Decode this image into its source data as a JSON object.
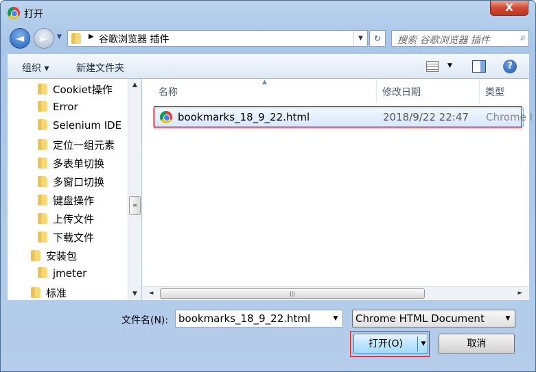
{
  "window": {
    "title": "打开",
    "close_label": "X"
  },
  "nav": {
    "back_glyph": "◄",
    "forward_glyph": "►",
    "history_glyph": "▼",
    "path_separator": "▶",
    "path": "谷歌浏览器 插件",
    "refresh_glyph": "↻",
    "search_placeholder": "搜索 谷歌浏览器 插件"
  },
  "toolbar": {
    "organize": "组织 ▾",
    "new_folder": "新建文件夹",
    "help_glyph": "?"
  },
  "sidebar": {
    "items": [
      {
        "label": "Cookiet操作"
      },
      {
        "label": "Error"
      },
      {
        "label": "Selenium IDE"
      },
      {
        "label": "定位一组元素"
      },
      {
        "label": "多表单切换"
      },
      {
        "label": "多窗口切换"
      },
      {
        "label": "键盘操作"
      },
      {
        "label": "上传文件"
      },
      {
        "label": "下载文件"
      },
      {
        "label": "安装包"
      },
      {
        "label": "jmeter"
      },
      {
        "label": "标准"
      }
    ]
  },
  "columns": {
    "name": "名称",
    "modified": "修改日期",
    "type": "类型"
  },
  "files": [
    {
      "name": "bookmarks_18_9_22.html",
      "modified": "2018/9/22 22:47",
      "type": "Chrome I"
    }
  ],
  "bottom": {
    "filename_label": "文件名(N):",
    "filename_value": "bookmarks_18_9_22.html",
    "filetype_value": "Chrome HTML Document",
    "open_label": "打开(O)",
    "cancel_label": "取消"
  },
  "colors": {
    "selection_outline": "#e0212d",
    "accent": "#2a4f86"
  }
}
